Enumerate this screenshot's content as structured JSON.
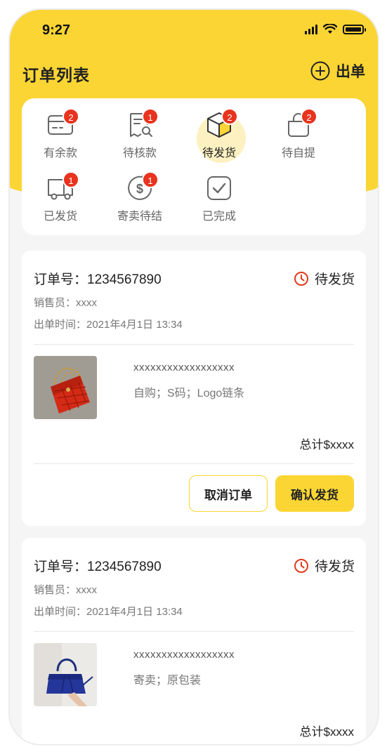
{
  "status_bar": {
    "time": "9:27"
  },
  "header": {
    "title": "订单列表",
    "new_order_label": "出单"
  },
  "status_tabs": [
    {
      "label": "有余款",
      "badge": "2",
      "icon": "card-icon"
    },
    {
      "label": "待核款",
      "badge": "1",
      "icon": "receipt-search-icon"
    },
    {
      "label": "待发货",
      "badge": "2",
      "icon": "box-icon",
      "active": true
    },
    {
      "label": "待自提",
      "badge": "2",
      "icon": "bag-icon"
    },
    {
      "label": "已发货",
      "badge": "1",
      "icon": "truck-icon"
    },
    {
      "label": "寄卖待结",
      "badge": "1",
      "icon": "dollar-icon"
    },
    {
      "label": "已完成",
      "badge": "",
      "icon": "check-icon"
    }
  ],
  "orders": [
    {
      "order_no": "订单号：1234567890",
      "status": "待发货",
      "seller": "销售员：xxxx",
      "time": "出单时间：2021年4月1日 13:34",
      "item_name": "xxxxxxxxxxxxxxxxxx",
      "item_spec": "自购；S码；Logo链条",
      "total": "总计$xxxx",
      "cancel_label": "取消订单",
      "confirm_label": "确认发货"
    },
    {
      "order_no": "订单号：1234567890",
      "status": "待发货",
      "seller": "销售员：xxxx",
      "time": "出单时间：2021年4月1日 13:34",
      "item_name": "xxxxxxxxxxxxxxxxxx",
      "item_spec": "寄卖；原包装",
      "total": "总计$xxxx"
    }
  ],
  "colors": {
    "accent": "#fbd534",
    "badge": "#e8331e",
    "status_icon": "#e03a1e"
  }
}
